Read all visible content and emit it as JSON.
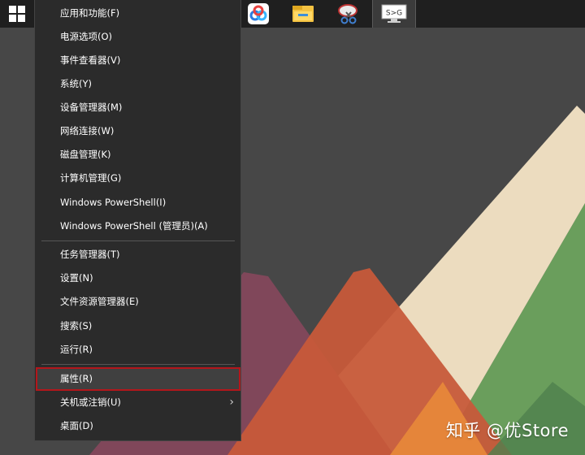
{
  "taskbar": {
    "apps": [
      {
        "icon": "baidu-netdisk-icon"
      },
      {
        "icon": "file-explorer-icon"
      },
      {
        "icon": "snipping-tool-icon"
      },
      {
        "icon": "monitor-switch-icon",
        "label": "S>G"
      }
    ]
  },
  "menu": {
    "items_group1": [
      "应用和功能(F)",
      "电源选项(O)",
      "事件查看器(V)",
      "系统(Y)",
      "设备管理器(M)",
      "网络连接(W)",
      "磁盘管理(K)",
      "计算机管理(G)",
      "Windows PowerShell(I)",
      "Windows PowerShell (管理员)(A)"
    ],
    "items_group2": [
      "任务管理器(T)",
      "设置(N)",
      "文件资源管理器(E)",
      "搜索(S)",
      "运行(R)"
    ],
    "items_group3": [
      "属性(R)",
      "关机或注销(U)",
      "桌面(D)"
    ],
    "highlight_color": "#b4161b"
  },
  "watermark": "知乎 @优Store"
}
